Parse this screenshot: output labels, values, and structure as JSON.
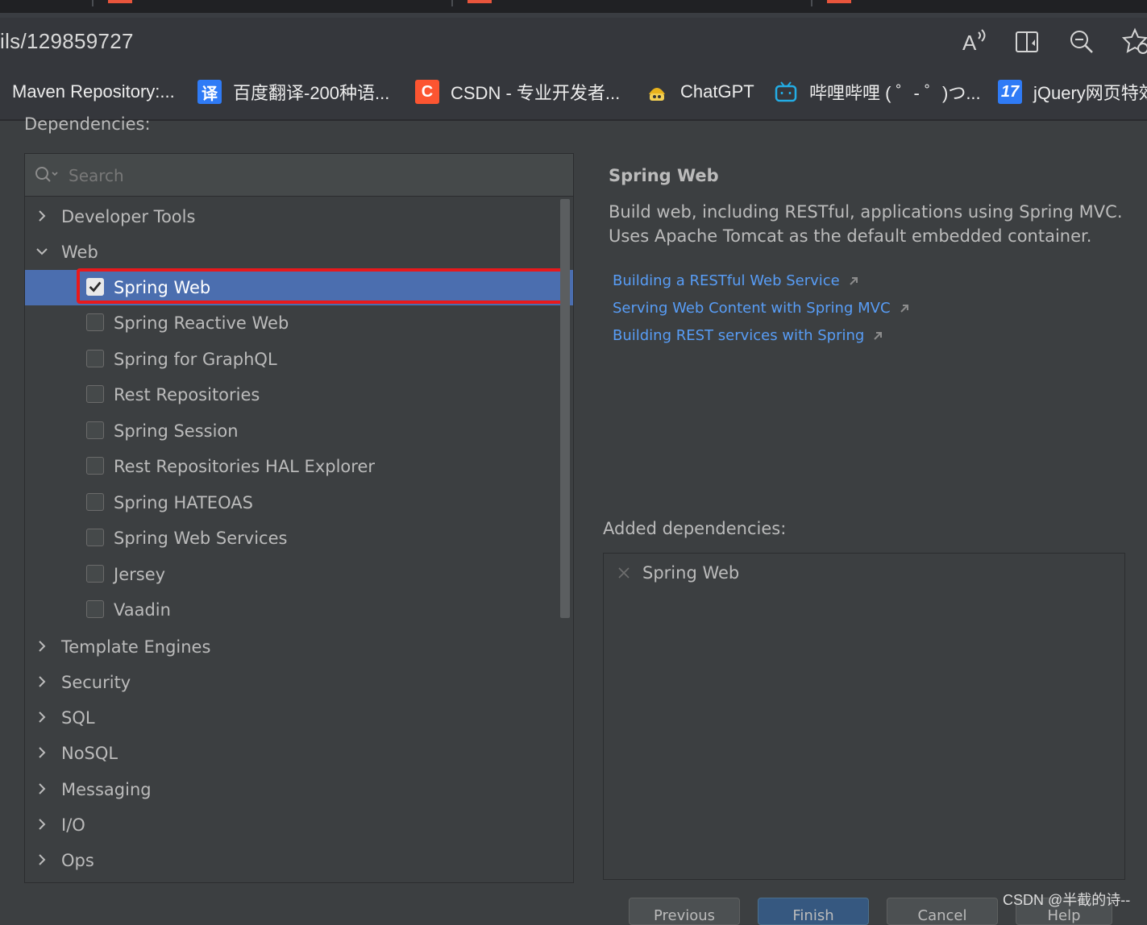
{
  "browser": {
    "url_fragment": "ils/129859727",
    "icons": [
      "read-aloud-icon",
      "immersive-reader-icon",
      "zoom-out-icon",
      "add-favorite-icon"
    ],
    "bookmarks": [
      {
        "label": "Maven Repository:...",
        "icon": "none"
      },
      {
        "label": "百度翻译-200种语...",
        "icon_text": "译",
        "icon_color": "#2f7bf6"
      },
      {
        "label": "CSDN - 专业开发者...",
        "icon_text": "C",
        "icon_color": "#fc5531"
      },
      {
        "label": "ChatGPT",
        "icon": "robot-icon"
      },
      {
        "label": "哔哩哔哩 ( ゜- ゜)つ...",
        "icon": "bilibili-tv-icon",
        "icon_color": "#23ade5"
      },
      {
        "label": "jQuery网页特效",
        "icon_text": "17",
        "icon_color": "#2f7bf6"
      }
    ]
  },
  "dependencies": {
    "label": "Dependencies:",
    "search_placeholder": "Search",
    "tree": [
      {
        "label": "Developer Tools",
        "expanded": false
      },
      {
        "label": "Web",
        "expanded": true,
        "children": [
          {
            "label": "Spring Web",
            "checked": true,
            "selected": true
          },
          {
            "label": "Spring Reactive Web",
            "checked": false
          },
          {
            "label": "Spring for GraphQL",
            "checked": false
          },
          {
            "label": "Rest Repositories",
            "checked": false
          },
          {
            "label": "Spring Session",
            "checked": false
          },
          {
            "label": "Rest Repositories HAL Explorer",
            "checked": false
          },
          {
            "label": "Spring HATEOAS",
            "checked": false
          },
          {
            "label": "Spring Web Services",
            "checked": false
          },
          {
            "label": "Jersey",
            "checked": false
          },
          {
            "label": "Vaadin",
            "checked": false
          }
        ]
      },
      {
        "label": "Template Engines",
        "expanded": false
      },
      {
        "label": "Security",
        "expanded": false
      },
      {
        "label": "SQL",
        "expanded": false
      },
      {
        "label": "NoSQL",
        "expanded": false
      },
      {
        "label": "Messaging",
        "expanded": false
      },
      {
        "label": "I/O",
        "expanded": false
      },
      {
        "label": "Ops",
        "expanded": false
      }
    ]
  },
  "detail": {
    "title": "Spring Web",
    "description": "Build web, including RESTful, applications using Spring MVC. Uses Apache Tomcat as the default embedded container.",
    "links": [
      "Building a RESTful Web Service",
      "Serving Web Content with Spring MVC",
      "Building REST services with Spring"
    ]
  },
  "added": {
    "label": "Added dependencies:",
    "items": [
      "Spring Web"
    ]
  },
  "footer_buttons": [
    "Previous",
    "Finish",
    "Cancel",
    "Help"
  ],
  "watermark": "CSDN @半截的诗--",
  "colors": {
    "panel_bg": "#3c3f41",
    "selection": "#4b6eaf",
    "highlight_box": "#e8191c",
    "link": "#589df6"
  }
}
